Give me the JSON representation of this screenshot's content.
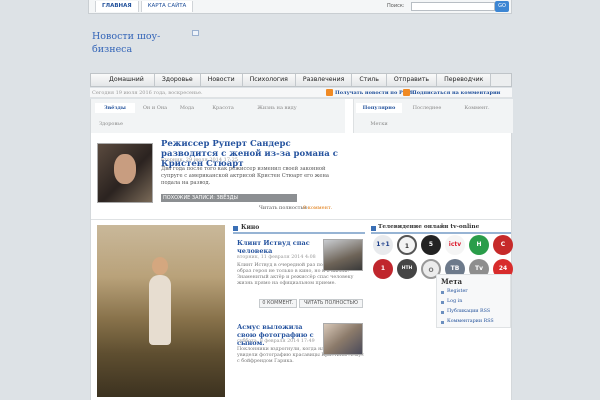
{
  "topbar": {
    "nav": [
      "ГЛАВНАЯ",
      "КАРТА САЙТА"
    ],
    "search_label": "Поиск:",
    "search_button": "GO"
  },
  "site": {
    "title": "Новости шоу-бизнеса"
  },
  "mainnav": [
    "Домашний",
    "Здоровье",
    "Новости",
    "Психология",
    "Развлечения",
    "Стиль",
    "Отправить",
    "Переводчик"
  ],
  "infobar": {
    "date_text": "Сегодня 19 июля 2016 года, воскресенье.",
    "rss_posts": "Получать новости по РСМС",
    "rss_comments": "Подписаться на комментарии"
  },
  "category_tabs": [
    "Звёзды",
    "Он и Она",
    "Мода",
    "Красота",
    "Жизнь на виду",
    "Здоровье"
  ],
  "right_tabs": [
    "Популярно",
    "Последнее",
    "Коммент.",
    "Метки"
  ],
  "featured": {
    "title": "Режиссер Руперт Сандерс разводится с женой из-за романа с Кристен Стюарт",
    "meta": "вторник, 29 июля 2014 17:25",
    "body": "Два года после того как режиссер изменил своей законной супруге с американской актрисой Кристен Стюарт его жена подала на развод.",
    "similar": "ПОХОЖИЕ ЗАПИСИ: ЗВЁЗДЫ",
    "read_more": "Читать полностью",
    "comments": "0 коммент."
  },
  "kino": {
    "heading": "Кино",
    "articles": [
      {
        "title": "Клинт Иствуд спас человека",
        "meta": "вторник, 11 февраля 2014 4:08",
        "body": "Клинт Иствуд в очередной раз подтвердил свой образ героя не только в кино, но и в жизни. Знаменитый актёр и режиссёр спас человеку жизнь прямо на официальном приеме.",
        "comment_btn": "0 КОММЕНТ.",
        "read_btn": "ЧИТАТЬ ПОЛНОСТЬЮ"
      },
      {
        "title": "Асмус выложила свою фотографию с сыном.",
        "meta": "суббота, 8 февраля 2014 17:49",
        "body": "Поклонники вздрогнули, когда на днях в сети увидели фотографию красавицы Кристины Асмус с бойфрендом Гарика."
      }
    ]
  },
  "tv": {
    "heading": "Телевидение онлайн tv-online",
    "channels": [
      "1+1",
      "1",
      "5",
      "ictv",
      "Н",
      "1",
      "НТН",
      "О",
      "ТВ",
      "Tv",
      "С",
      "24"
    ]
  },
  "meta": {
    "heading": "Мета",
    "links": [
      "Register",
      "Log in",
      "Публикации RSS",
      "Комментарии RSS"
    ]
  },
  "colors": {
    "accent": "#24529e",
    "rss": "#f08a24",
    "search_button": "#3d86d3"
  }
}
